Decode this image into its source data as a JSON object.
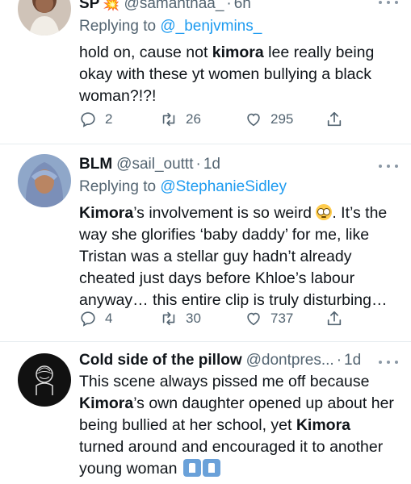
{
  "tweets": [
    {
      "name": "SP",
      "name_emoji": "💥",
      "handle": "@samanthaa_",
      "time": "6h",
      "reply_prefix": "Replying to",
      "reply_to": "@_benjvmins_",
      "text_parts": [
        "hold on, cause not ",
        "kimora",
        " lee really being okay with these yt women bullying a black woman?!?!"
      ],
      "replies": "2",
      "retweets": "26",
      "likes": "295"
    },
    {
      "name": "BLM",
      "handle": "@sail_outtt",
      "time": "1d",
      "reply_prefix": "Replying to",
      "reply_to": "@StephanieSidley",
      "text_parts": [
        "Kimora",
        "’s involvement is so weird ",
        ". It’s the way she glorifies ‘baby daddy’ for me, like Tristan was a stellar guy hadn’t already cheated just days before Khloe’s labour anyway… this entire clip is truly disturbing…"
      ],
      "replies": "4",
      "retweets": "30",
      "likes": "737"
    },
    {
      "name": "Cold side of the pillow",
      "handle": "@dontpres...",
      "time": "1d",
      "text_parts": [
        "This scene always pissed me off because ",
        "Kimora",
        "’s own daughter opened up about her being bullied at her school, yet ",
        "Kimora",
        " turned around and encouraged it to another young woman "
      ]
    }
  ],
  "icons": {
    "reply": "reply-icon",
    "retweet": "retweet-icon",
    "like": "heart-icon",
    "share": "share-icon",
    "more": "more-icon"
  },
  "colors": {
    "link": "#1d9bf0",
    "secondary": "#536471",
    "primary": "#0f1419",
    "divider": "#e6ecf0"
  }
}
